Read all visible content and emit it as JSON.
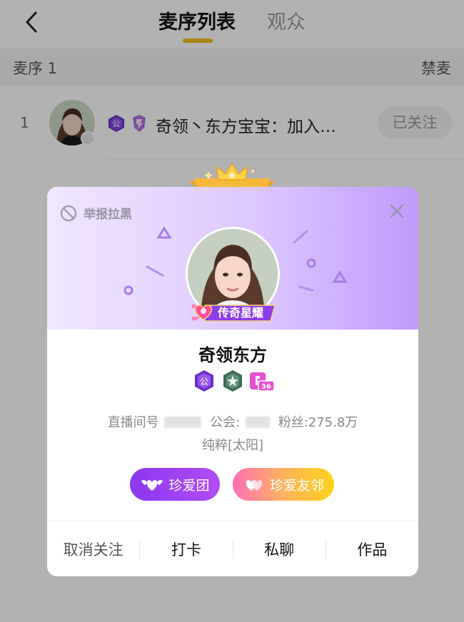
{
  "header": {
    "tabs": [
      {
        "label": "麦序列表",
        "active": true
      },
      {
        "label": "观众",
        "active": false
      }
    ],
    "accent_color": "#f4c316"
  },
  "section": {
    "title": "麦序 1",
    "action_label": "禁麦"
  },
  "mic_list": [
    {
      "index": "1",
      "name": "奇领丶东方宝宝：加入…",
      "badge_guild": "公",
      "follow_label": "已关注"
    }
  ],
  "profile_card": {
    "report_label": "举报拉黑",
    "rank_title": "传奇星耀",
    "name": "奇领东方",
    "badges": [
      {
        "icon": "guild-badge-icon",
        "text": "公"
      },
      {
        "icon": "star-badge-icon",
        "text": ""
      },
      {
        "icon": "level-badge-icon",
        "text": "36"
      }
    ],
    "room_label": "直播间号",
    "guild_label": "公会:",
    "fans_label": "粉丝:275.8万",
    "tag_line": "纯粹[太阳]",
    "fan_team_label": "珍爱团",
    "friend_label": "珍爱友邻",
    "actions": [
      "取消关注",
      "打卡",
      "私聊",
      "作品"
    ],
    "header_gradient": [
      "#f1e7ff",
      "#c19bfb"
    ]
  }
}
